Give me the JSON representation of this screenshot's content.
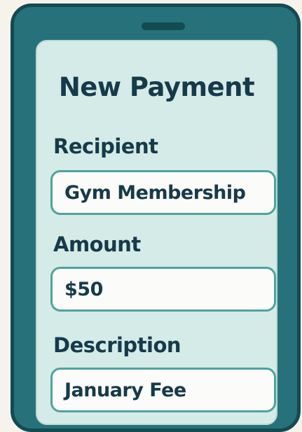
{
  "form": {
    "title": "New Payment",
    "fields": [
      {
        "label": "Recipient",
        "value": "Gym Membership"
      },
      {
        "label": "Amount",
        "value": "$50"
      },
      {
        "label": "Description",
        "value": "January Fee"
      }
    ]
  },
  "colors": {
    "phone_body": "#27727a",
    "phone_border": "#154a52",
    "screen": "#d5ebe7",
    "field_border": "#4fa39f",
    "text": "#163a4a"
  }
}
